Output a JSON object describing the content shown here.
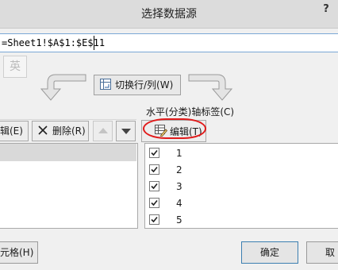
{
  "window": {
    "title": "选择数据源",
    "help": "?"
  },
  "data_range": {
    "value": "=Sheet1!$A$1:$E$11"
  },
  "ime": {
    "label": "英"
  },
  "switch": {
    "label": "切换行/列(W)"
  },
  "legend_pane": {
    "edit_label": "辑(E)",
    "delete_label": "删除(R)"
  },
  "axis_pane": {
    "title": "水平(分类)轴标签(C)",
    "edit_label": "编辑(T)",
    "items": [
      {
        "label": "1",
        "checked": true
      },
      {
        "label": "2",
        "checked": true
      },
      {
        "label": "3",
        "checked": true
      },
      {
        "label": "4",
        "checked": true
      },
      {
        "label": "5",
        "checked": true
      }
    ]
  },
  "footer": {
    "hidden_cells_label": "元格(H)",
    "ok_label": "确定",
    "cancel_label": "取"
  }
}
